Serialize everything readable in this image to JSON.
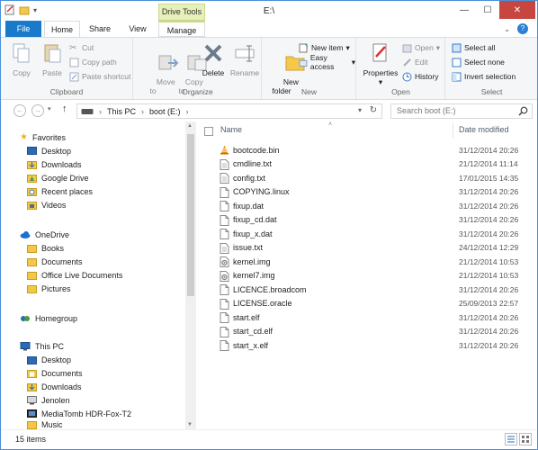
{
  "window": {
    "title": "E:\\",
    "min": "—",
    "max": "☐",
    "close": "✕"
  },
  "tabs": {
    "file": "File",
    "home": "Home",
    "share": "Share",
    "view": "View",
    "context_group": "Drive Tools",
    "manage": "Manage",
    "help": "?"
  },
  "ribbon": {
    "clipboard": {
      "label": "Clipboard",
      "copy": "Copy",
      "paste": "Paste",
      "cut": "Cut",
      "copy_path": "Copy path",
      "paste_shortcut": "Paste shortcut"
    },
    "organize": {
      "label": "Organize",
      "move_to": "Move\nto",
      "copy_to": "Copy\nto",
      "delete": "Delete",
      "rename": "Rename"
    },
    "new": {
      "label": "New",
      "new_folder": "New\nfolder",
      "new_item": "New item",
      "easy_access": "Easy access"
    },
    "open": {
      "label": "Open",
      "properties": "Properties",
      "open": "Open",
      "edit": "Edit",
      "history": "History"
    },
    "select": {
      "label": "Select",
      "select_all": "Select all",
      "select_none": "Select none",
      "invert_selection": "Invert selection"
    }
  },
  "address": {
    "this_pc": "This PC",
    "drive": "boot (E:)",
    "search_placeholder": "Search boot (E:)"
  },
  "nav": {
    "favorites": "Favorites",
    "fav_items": [
      "Desktop",
      "Downloads",
      "Google Drive",
      "Recent places",
      "Videos"
    ],
    "onedrive": "OneDrive",
    "onedrive_items": [
      "Books",
      "Documents",
      "Office Live Documents",
      "Pictures"
    ],
    "homegroup": "Homegroup",
    "this_pc": "This PC",
    "pc_items": [
      "Desktop",
      "Documents",
      "Downloads",
      "Jenolen",
      "MediaTomb HDR-Fox-T2",
      "Music"
    ]
  },
  "list": {
    "col_name": "Name",
    "col_date": "Date modified",
    "files": [
      {
        "name": "bootcode.bin",
        "date": "31/12/2014 20:26",
        "icon": "vlc-cone-icon"
      },
      {
        "name": "cmdline.txt",
        "date": "21/12/2014 11:14",
        "icon": "text-file-icon"
      },
      {
        "name": "config.txt",
        "date": "17/01/2015 14:35",
        "icon": "text-file-icon"
      },
      {
        "name": "COPYING.linux",
        "date": "31/12/2014 20:26",
        "icon": "file-icon"
      },
      {
        "name": "fixup.dat",
        "date": "31/12/2014 20:26",
        "icon": "file-icon"
      },
      {
        "name": "fixup_cd.dat",
        "date": "31/12/2014 20:26",
        "icon": "file-icon"
      },
      {
        "name": "fixup_x.dat",
        "date": "31/12/2014 20:26",
        "icon": "file-icon"
      },
      {
        "name": "issue.txt",
        "date": "24/12/2014 12:29",
        "icon": "text-file-icon"
      },
      {
        "name": "kernel.img",
        "date": "21/12/2014 10:53",
        "icon": "disk-image-icon"
      },
      {
        "name": "kernel7.img",
        "date": "21/12/2014 10:53",
        "icon": "disk-image-icon"
      },
      {
        "name": "LICENCE.broadcom",
        "date": "31/12/2014 20:26",
        "icon": "file-icon"
      },
      {
        "name": "LICENSE.oracle",
        "date": "25/09/2013 22:57",
        "icon": "file-icon"
      },
      {
        "name": "start.elf",
        "date": "31/12/2014 20:26",
        "icon": "file-icon"
      },
      {
        "name": "start_cd.elf",
        "date": "31/12/2014 20:26",
        "icon": "file-icon"
      },
      {
        "name": "start_x.elf",
        "date": "31/12/2014 20:26",
        "icon": "file-icon"
      }
    ]
  },
  "status": {
    "item_count": "15 items"
  }
}
